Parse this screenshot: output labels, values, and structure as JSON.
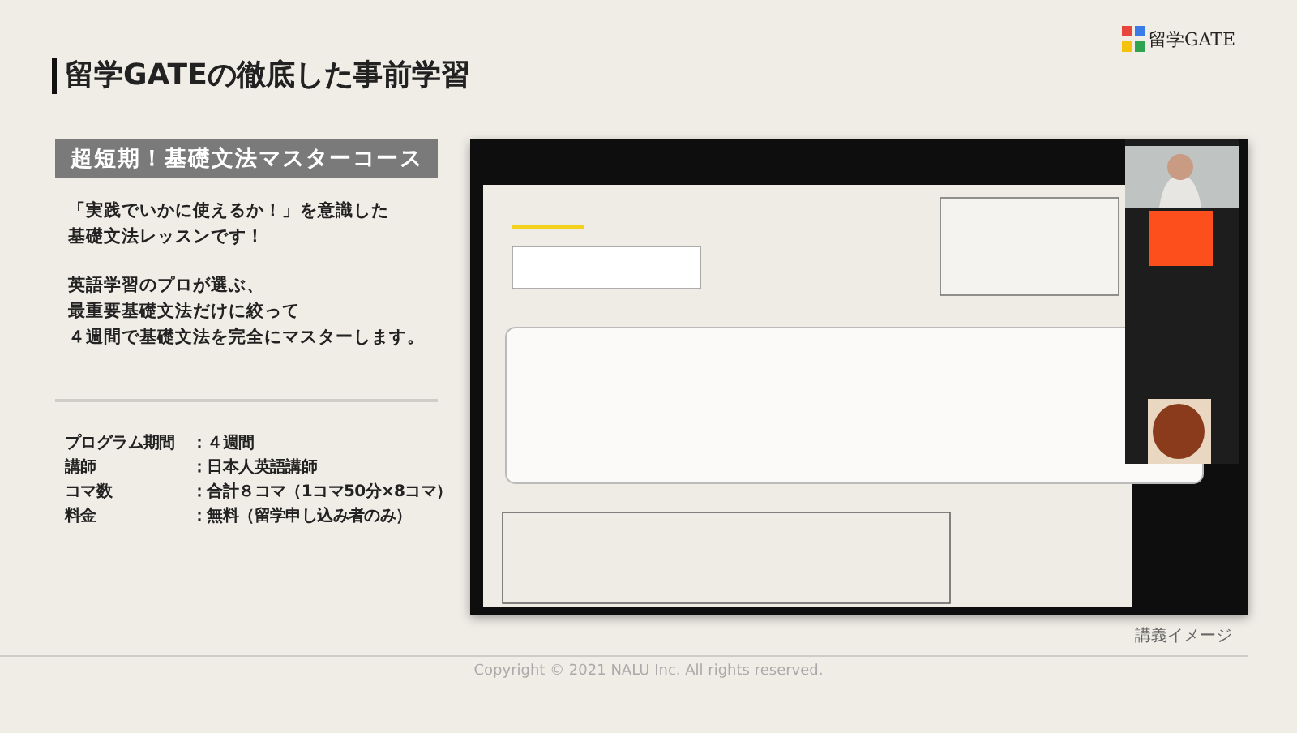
{
  "header": {
    "title": "留学GATEの徹底した事前学習",
    "logo_text": "留学GATE"
  },
  "course": {
    "title": "超短期！基礎文法マスターコース",
    "paragraphs": [
      [
        "「実践でいかに使えるか！」を意識した",
        " 基礎文法レッスンです！"
      ],
      [
        "英語学習のプロが選ぶ、",
        "最重要基礎文法だけに絞って",
        "４週間で基礎文法を完全にマスターします。"
      ]
    ],
    "info": [
      {
        "label": "プログラム期間",
        "value": "：４週間"
      },
      {
        "label": "講師",
        "value": "：日本人英語講師"
      },
      {
        "label": "コマ数",
        "value": "：合計８コマ（1コマ50分×8コマ）"
      },
      {
        "label": "料金",
        "value": "：無料（留学申し込み者のみ）"
      }
    ]
  },
  "lecture": {
    "kind": "picture",
    "caption": "講義イメージ"
  },
  "footer": {
    "copyright": "Copyright © 2021 NALU Inc. All rights reserved."
  }
}
